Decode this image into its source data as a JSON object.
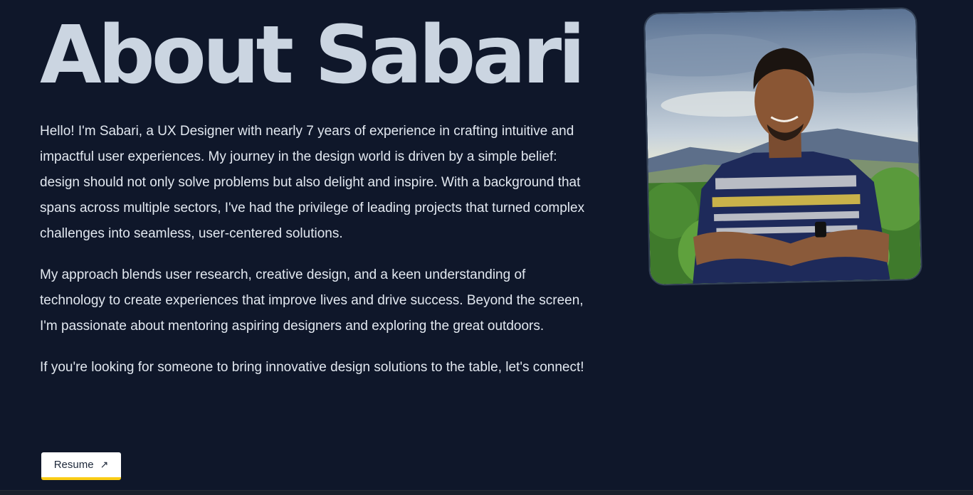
{
  "about": {
    "title": "About Sabari",
    "paragraphs": [
      "Hello! I'm Sabari, a UX Designer with nearly 7 years of experience in crafting intuitive and impactful user experiences. My journey in the design world is driven by a simple belief: design should not only solve problems but also delight and inspire. With a background that spans across multiple sectors, I've had the privilege of leading projects that turned complex challenges into seamless, user-centered solutions.",
      "My approach blends user research, creative design, and a keen understanding of technology to create experiences that improve lives and drive success. Beyond the screen, I'm passionate about mentoring aspiring designers and exploring the great outdoors.",
      "If you're looking for someone to bring innovative design solutions to the table, let's connect!"
    ],
    "resume_button": {
      "label": "Resume",
      "icon": "arrow-up-right-icon"
    },
    "photo": {
      "subject": "portrait-photo"
    }
  },
  "colors": {
    "background": "#0f172a",
    "title": "#cbd5e1",
    "body_text": "#e2e8f0",
    "button_background": "#ffffff",
    "button_accent": "#facc15"
  }
}
